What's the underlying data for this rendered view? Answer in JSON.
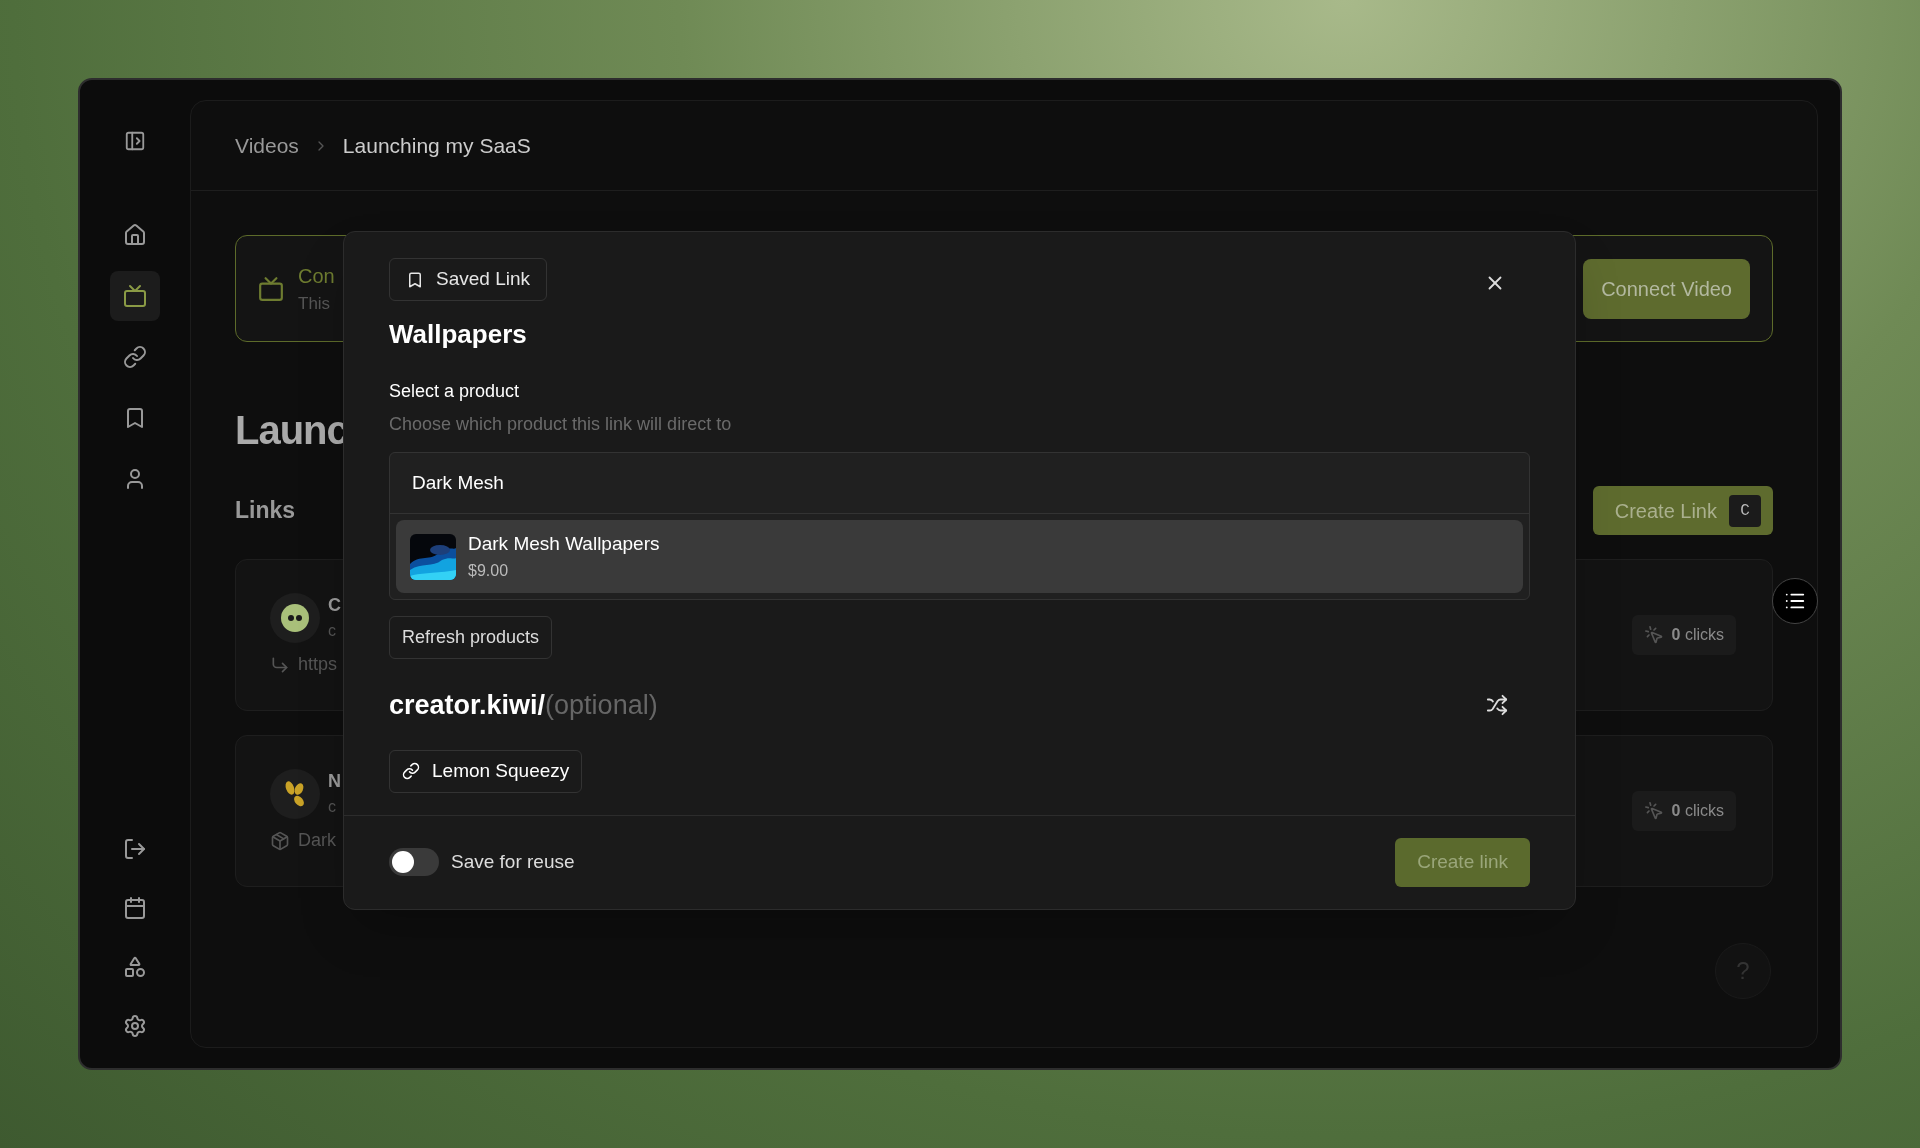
{
  "sidebar": {
    "items": [
      {
        "selected": false
      },
      {
        "selected": true
      },
      {
        "selected": false
      },
      {
        "selected": false
      },
      {
        "selected": false
      }
    ]
  },
  "breadcrumb": [
    "Videos",
    "Launching my SaaS"
  ],
  "banner": {
    "title": "Con",
    "subtitle": "This",
    "button": "Connect Video"
  },
  "page_title": "Launc",
  "links_section": {
    "title": "Links",
    "create_button": "Create Link",
    "shortcut": "C"
  },
  "links": [
    {
      "kind": "url",
      "title": "C",
      "subtitle": "c",
      "target": "https",
      "clicks": "**0** clicks"
    },
    {
      "kind": "product",
      "title": "N",
      "subtitle": "c",
      "target": "Dark",
      "clicks": "**0** clicks"
    }
  ],
  "help_button": "?",
  "modal": {
    "badge": "Saved Link",
    "title": "Wallpapers",
    "section_label": "Select a product",
    "section_hint": "Choose which product this link will direct to",
    "search_value": "Dark Mesh",
    "results": [
      {
        "name": "Dark Mesh Wallpapers",
        "price": "$9.00",
        "selected": true
      }
    ],
    "refresh_button": "Refresh products",
    "slug_prefix": "creator.kiwi/",
    "slug_placeholder": "(optional)",
    "provider_chip": "Lemon Squeezy",
    "save_toggle": {
      "label": "Save for reuse",
      "on": false
    },
    "submit_button": "Create link",
    "submit_disabled": true
  }
}
